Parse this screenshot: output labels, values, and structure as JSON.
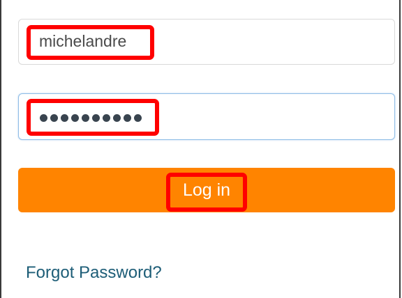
{
  "login_form": {
    "username_value": "michelandre",
    "password_masked": "••••••••••",
    "password_length": 10,
    "login_button_label": "Log in",
    "forgot_password_link": "Forgot Password?"
  },
  "colors": {
    "login_button": "#ff8400",
    "highlight": "#ff0000",
    "link": "#1d5d77",
    "focused_border": "#8fbde6"
  }
}
